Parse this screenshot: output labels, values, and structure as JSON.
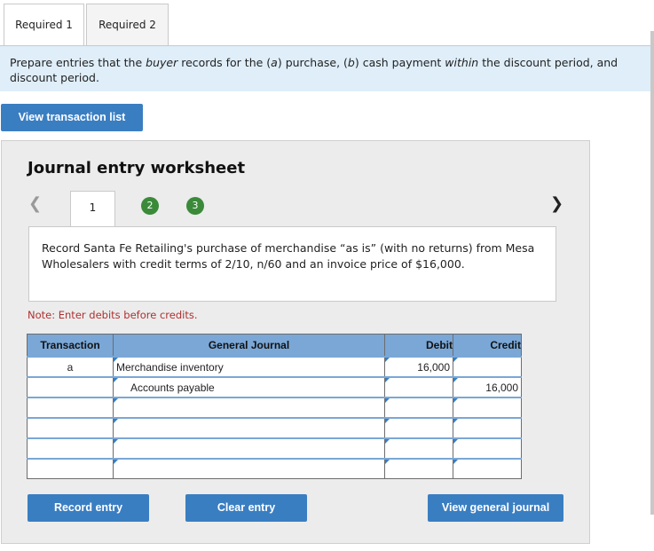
{
  "tabs": [
    {
      "label": "Required 1"
    },
    {
      "label": "Required 2"
    }
  ],
  "instructions": {
    "p1": "Prepare entries that the ",
    "p2": "buyer",
    "p3": " records for the (",
    "p4": "a",
    "p5": ") purchase, (",
    "p6": "b",
    "p7": ") cash payment ",
    "p8": "within",
    "p9": " the discount period, and",
    "line2": "discount period."
  },
  "view_transaction_label": "View transaction list",
  "worksheet": {
    "title": "Journal entry worksheet",
    "steps": [
      "1",
      "2",
      "3"
    ],
    "description": "Record Santa Fe Retailing's purchase of merchandise “as is” (with no returns) from Mesa Wholesalers with credit terms of 2/10, n/60 and an invoice price of $16,000.",
    "note": "Note: Enter debits before credits."
  },
  "journal": {
    "headers": {
      "transaction": "Transaction",
      "general_journal": "General Journal",
      "debit": "Debit",
      "credit": "Credit"
    },
    "rows": [
      {
        "transaction": "a",
        "account": "Merchandise inventory",
        "debit": "16,000",
        "credit": ""
      },
      {
        "transaction": "",
        "account": "Accounts payable",
        "debit": "",
        "credit": "16,000"
      },
      {
        "transaction": "",
        "account": "",
        "debit": "",
        "credit": ""
      },
      {
        "transaction": "",
        "account": "",
        "debit": "",
        "credit": ""
      },
      {
        "transaction": "",
        "account": "",
        "debit": "",
        "credit": ""
      },
      {
        "transaction": "",
        "account": "",
        "debit": "",
        "credit": ""
      }
    ]
  },
  "buttons": {
    "record": "Record entry",
    "clear": "Clear entry",
    "view_journal": "View general journal"
  },
  "colors": {
    "accent": "#3a7ec2",
    "header": "#7aa7d6",
    "step_done": "#3a8a3a",
    "instructions_bg": "#dfeef9"
  }
}
